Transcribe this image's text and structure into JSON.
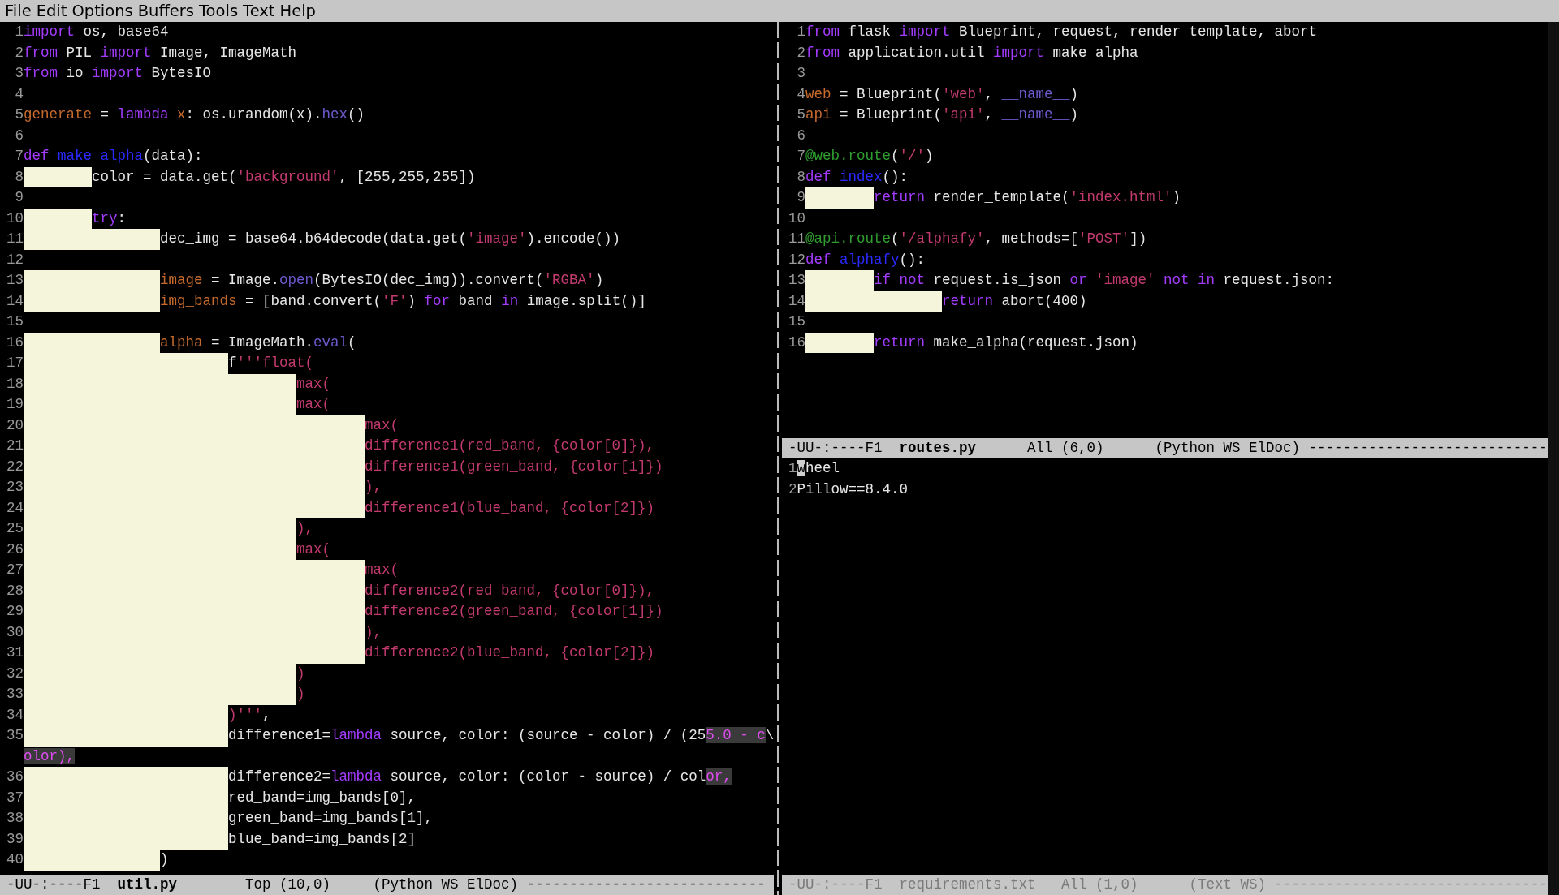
{
  "menu_bar": [
    "File",
    "Edit",
    "Options",
    "Buffers",
    "Tools",
    "Text",
    "Help"
  ],
  "left_pane": {
    "lines": [
      {
        "num": "1",
        "code": [
          {
            "kind": "keyword",
            "text": "import"
          },
          {
            "kind": "plain",
            "text": " os, base64"
          }
        ]
      },
      {
        "num": "2",
        "code": [
          {
            "kind": "keyword",
            "text": "from"
          },
          {
            "kind": "plain",
            "text": " PIL "
          },
          {
            "kind": "keyword",
            "text": "import"
          },
          {
            "kind": "plain",
            "text": " Image, ImageMath"
          }
        ]
      },
      {
        "num": "3",
        "code": [
          {
            "kind": "keyword",
            "text": "from"
          },
          {
            "kind": "plain",
            "text": " io "
          },
          {
            "kind": "keyword",
            "text": "import"
          },
          {
            "kind": "plain",
            "text": " BytesIO"
          }
        ]
      },
      {
        "num": "4"
      },
      {
        "num": "5",
        "code": [
          {
            "kind": "variable",
            "text": "generate"
          },
          {
            "kind": "plain",
            "text": " = "
          },
          {
            "kind": "keyword",
            "text": "lambda "
          },
          {
            "kind": "variable",
            "text": "x"
          },
          {
            "kind": "plain",
            "text": ": os.urandom(x)."
          },
          {
            "kind": "builtin",
            "text": "hex"
          },
          {
            "kind": "plain",
            "text": "()"
          }
        ]
      },
      {
        "num": "6"
      },
      {
        "num": "7",
        "code": [
          {
            "kind": "keyword",
            "text": "def "
          },
          {
            "kind": "function",
            "text": "make_alpha"
          },
          {
            "kind": "plain",
            "text": "(data):"
          }
        ]
      },
      {
        "num": "8",
        "code": [
          {
            "kind": "tab"
          },
          {
            "kind": "plain",
            "text": "color = data.get("
          },
          {
            "kind": "string",
            "text": "'background'"
          },
          {
            "kind": "plain",
            "text": ", [255,255,255])"
          }
        ]
      },
      {
        "num": "9"
      },
      {
        "num": "10",
        "code": [
          {
            "kind": "tab"
          },
          {
            "kind": "keyword",
            "text": "try"
          },
          {
            "kind": "plain",
            "text": ":"
          }
        ]
      },
      {
        "num": "11",
        "code": [
          {
            "kind": "tab"
          },
          {
            "kind": "tab"
          },
          {
            "kind": "plain",
            "text": "dec_img = base64.b64decode(data.get("
          },
          {
            "kind": "string",
            "text": "'image'"
          },
          {
            "kind": "plain",
            "text": ").encode())"
          }
        ]
      },
      {
        "num": "12"
      },
      {
        "num": "13",
        "code": [
          {
            "kind": "tab"
          },
          {
            "kind": "tab"
          },
          {
            "kind": "variable",
            "text": "image"
          },
          {
            "kind": "plain",
            "text": " = Image."
          },
          {
            "kind": "builtin",
            "text": "open"
          },
          {
            "kind": "plain",
            "text": "(BytesIO(dec_img)).convert("
          },
          {
            "kind": "string",
            "text": "'RGBA'"
          },
          {
            "kind": "plain",
            "text": ")"
          }
        ]
      },
      {
        "num": "14",
        "code": [
          {
            "kind": "tab"
          },
          {
            "kind": "tab"
          },
          {
            "kind": "variable",
            "text": "img_bands"
          },
          {
            "kind": "plain",
            "text": " = [band.convert("
          },
          {
            "kind": "string",
            "text": "'F'"
          },
          {
            "kind": "plain",
            "text": ") "
          },
          {
            "kind": "keyword",
            "text": "for"
          },
          {
            "kind": "plain",
            "text": " band "
          },
          {
            "kind": "keyword",
            "text": "in"
          },
          {
            "kind": "plain",
            "text": " image.split()]"
          }
        ]
      },
      {
        "num": "15"
      },
      {
        "num": "16",
        "code": [
          {
            "kind": "tab"
          },
          {
            "kind": "tab"
          },
          {
            "kind": "variable",
            "text": "alpha"
          },
          {
            "kind": "plain",
            "text": " = ImageMath."
          },
          {
            "kind": "builtin",
            "text": "eval"
          },
          {
            "kind": "plain",
            "text": "("
          }
        ]
      },
      {
        "num": "17",
        "code": [
          {
            "kind": "tab"
          },
          {
            "kind": "tab"
          },
          {
            "kind": "tab"
          },
          {
            "kind": "plain",
            "text": "f"
          },
          {
            "kind": "string",
            "text": "'''float("
          }
        ]
      },
      {
        "num": "18",
        "code": [
          {
            "kind": "tab"
          },
          {
            "kind": "tab"
          },
          {
            "kind": "tab"
          },
          {
            "kind": "tab"
          },
          {
            "kind": "string",
            "text": "max("
          }
        ]
      },
      {
        "num": "19",
        "code": [
          {
            "kind": "tab"
          },
          {
            "kind": "tab"
          },
          {
            "kind": "tab"
          },
          {
            "kind": "tab"
          },
          {
            "kind": "string",
            "text": "max("
          }
        ]
      },
      {
        "num": "20",
        "code": [
          {
            "kind": "tab"
          },
          {
            "kind": "tab"
          },
          {
            "kind": "tab"
          },
          {
            "kind": "tab"
          },
          {
            "kind": "tab"
          },
          {
            "kind": "string",
            "text": "max("
          }
        ]
      },
      {
        "num": "21",
        "code": [
          {
            "kind": "tab"
          },
          {
            "kind": "tab"
          },
          {
            "kind": "tab"
          },
          {
            "kind": "tab"
          },
          {
            "kind": "tab"
          },
          {
            "kind": "string",
            "text": "difference1(red_band, {color[0]}),"
          }
        ]
      },
      {
        "num": "22",
        "code": [
          {
            "kind": "tab"
          },
          {
            "kind": "tab"
          },
          {
            "kind": "tab"
          },
          {
            "kind": "tab"
          },
          {
            "kind": "tab"
          },
          {
            "kind": "string",
            "text": "difference1(green_band, {color[1]})"
          }
        ]
      },
      {
        "num": "23",
        "code": [
          {
            "kind": "tab"
          },
          {
            "kind": "tab"
          },
          {
            "kind": "tab"
          },
          {
            "kind": "tab"
          },
          {
            "kind": "tab"
          },
          {
            "kind": "string",
            "text": "),"
          }
        ]
      },
      {
        "num": "24",
        "code": [
          {
            "kind": "tab"
          },
          {
            "kind": "tab"
          },
          {
            "kind": "tab"
          },
          {
            "kind": "tab"
          },
          {
            "kind": "tab"
          },
          {
            "kind": "string",
            "text": "difference1(blue_band, {color[2]})"
          }
        ]
      },
      {
        "num": "25",
        "code": [
          {
            "kind": "tab"
          },
          {
            "kind": "tab"
          },
          {
            "kind": "tab"
          },
          {
            "kind": "tab"
          },
          {
            "kind": "string",
            "text": "),"
          }
        ]
      },
      {
        "num": "26",
        "code": [
          {
            "kind": "tab"
          },
          {
            "kind": "tab"
          },
          {
            "kind": "tab"
          },
          {
            "kind": "tab"
          },
          {
            "kind": "string",
            "text": "max("
          }
        ]
      },
      {
        "num": "27",
        "code": [
          {
            "kind": "tab"
          },
          {
            "kind": "tab"
          },
          {
            "kind": "tab"
          },
          {
            "kind": "tab"
          },
          {
            "kind": "tab"
          },
          {
            "kind": "string",
            "text": "max("
          }
        ]
      },
      {
        "num": "28",
        "code": [
          {
            "kind": "tab"
          },
          {
            "kind": "tab"
          },
          {
            "kind": "tab"
          },
          {
            "kind": "tab"
          },
          {
            "kind": "tab"
          },
          {
            "kind": "string",
            "text": "difference2(red_band, {color[0]}),"
          }
        ]
      },
      {
        "num": "29",
        "code": [
          {
            "kind": "tab"
          },
          {
            "kind": "tab"
          },
          {
            "kind": "tab"
          },
          {
            "kind": "tab"
          },
          {
            "kind": "tab"
          },
          {
            "kind": "string",
            "text": "difference2(green_band, {color[1]})"
          }
        ]
      },
      {
        "num": "30",
        "code": [
          {
            "kind": "tab"
          },
          {
            "kind": "tab"
          },
          {
            "kind": "tab"
          },
          {
            "kind": "tab"
          },
          {
            "kind": "tab"
          },
          {
            "kind": "string",
            "text": "),"
          }
        ]
      },
      {
        "num": "31",
        "code": [
          {
            "kind": "tab"
          },
          {
            "kind": "tab"
          },
          {
            "kind": "tab"
          },
          {
            "kind": "tab"
          },
          {
            "kind": "tab"
          },
          {
            "kind": "string",
            "text": "difference2(blue_band, {color[2]})"
          }
        ]
      },
      {
        "num": "32",
        "code": [
          {
            "kind": "tab"
          },
          {
            "kind": "tab"
          },
          {
            "kind": "tab"
          },
          {
            "kind": "tab"
          },
          {
            "kind": "string",
            "text": ")"
          }
        ]
      },
      {
        "num": "33",
        "code": [
          {
            "kind": "tab"
          },
          {
            "kind": "tab"
          },
          {
            "kind": "tab"
          },
          {
            "kind": "tab"
          },
          {
            "kind": "string",
            "text": ")"
          }
        ]
      },
      {
        "num": "34",
        "code": [
          {
            "kind": "tab"
          },
          {
            "kind": "tab"
          },
          {
            "kind": "tab"
          },
          {
            "kind": "string",
            "text": ")'''"
          },
          {
            "kind": "plain",
            "text": ","
          }
        ]
      },
      {
        "num": "35",
        "code": [
          {
            "kind": "tab"
          },
          {
            "kind": "tab"
          },
          {
            "kind": "tab"
          },
          {
            "kind": "plain",
            "text": "difference1="
          },
          {
            "kind": "keyword",
            "text": "lambda"
          },
          {
            "kind": "plain",
            "text": " source, color: (source - color) / (25"
          },
          {
            "kind": "long",
            "text": "5.0 - c"
          },
          {
            "kind": "plain",
            "text": "\\"
          }
        ]
      },
      {
        "code": [
          {
            "kind": "long",
            "text": "olor),"
          }
        ]
      },
      {
        "num": "36",
        "code": [
          {
            "kind": "tab"
          },
          {
            "kind": "tab"
          },
          {
            "kind": "tab"
          },
          {
            "kind": "plain",
            "text": "difference2="
          },
          {
            "kind": "keyword",
            "text": "lambda"
          },
          {
            "kind": "plain",
            "text": " source, color: (color - source) / col"
          },
          {
            "kind": "long",
            "text": "or,"
          }
        ]
      },
      {
        "num": "37",
        "code": [
          {
            "kind": "tab"
          },
          {
            "kind": "tab"
          },
          {
            "kind": "tab"
          },
          {
            "kind": "plain",
            "text": "red_band=img_bands[0],"
          }
        ]
      },
      {
        "num": "38",
        "code": [
          {
            "kind": "tab"
          },
          {
            "kind": "tab"
          },
          {
            "kind": "tab"
          },
          {
            "kind": "plain",
            "text": "green_band=img_bands[1],"
          }
        ]
      },
      {
        "num": "39",
        "code": [
          {
            "kind": "tab"
          },
          {
            "kind": "tab"
          },
          {
            "kind": "tab"
          },
          {
            "kind": "plain",
            "text": "blue_band=img_bands[2]"
          }
        ]
      },
      {
        "num": "40",
        "code": [
          {
            "kind": "tab"
          },
          {
            "kind": "tab"
          },
          {
            "kind": "plain",
            "text": ")"
          }
        ]
      }
    ],
    "mode_line": {
      "status": "-UU-:----F1",
      "buffer": "util.py",
      "position": "Top (10,0)",
      "mode": "(Python WS ElDoc)",
      "fill": "----------------------------",
      "active": true
    }
  },
  "right_pane": {
    "windows": [
      {
        "lines": [
          {
            "num": "1",
            "code": [
              {
                "kind": "keyword",
                "text": "from"
              },
              {
                "kind": "plain",
                "text": " flask "
              },
              {
                "kind": "keyword",
                "text": "import"
              },
              {
                "kind": "plain",
                "text": " Blueprint, request, render_template, abort"
              }
            ]
          },
          {
            "num": "2",
            "code": [
              {
                "kind": "keyword",
                "text": "from"
              },
              {
                "kind": "plain",
                "text": " application.util "
              },
              {
                "kind": "keyword",
                "text": "import"
              },
              {
                "kind": "plain",
                "text": " make_alpha"
              }
            ]
          },
          {
            "num": "3"
          },
          {
            "num": "4",
            "code": [
              {
                "kind": "variable",
                "text": "web"
              },
              {
                "kind": "plain",
                "text": " = Blueprint("
              },
              {
                "kind": "string",
                "text": "'web'"
              },
              {
                "kind": "plain",
                "text": ", "
              },
              {
                "kind": "builtin",
                "text": "__name__"
              },
              {
                "kind": "plain",
                "text": ")"
              }
            ]
          },
          {
            "num": "5",
            "code": [
              {
                "kind": "variable",
                "text": "api"
              },
              {
                "kind": "plain",
                "text": " = Blueprint("
              },
              {
                "kind": "string",
                "text": "'api'"
              },
              {
                "kind": "plain",
                "text": ", "
              },
              {
                "kind": "builtin",
                "text": "__name__"
              },
              {
                "kind": "plain",
                "text": ")"
              }
            ]
          },
          {
            "num": "6"
          },
          {
            "num": "7",
            "code": [
              {
                "kind": "decorator",
                "text": "@web.route"
              },
              {
                "kind": "plain",
                "text": "("
              },
              {
                "kind": "string",
                "text": "'/'"
              },
              {
                "kind": "plain",
                "text": ")"
              }
            ]
          },
          {
            "num": "8",
            "code": [
              {
                "kind": "keyword",
                "text": "def "
              },
              {
                "kind": "function",
                "text": "index"
              },
              {
                "kind": "plain",
                "text": "():"
              }
            ]
          },
          {
            "num": "9",
            "code": [
              {
                "kind": "tab"
              },
              {
                "kind": "keyword",
                "text": "return"
              },
              {
                "kind": "plain",
                "text": " render_template("
              },
              {
                "kind": "string",
                "text": "'index.html'"
              },
              {
                "kind": "plain",
                "text": ")"
              }
            ]
          },
          {
            "num": "10"
          },
          {
            "num": "11",
            "code": [
              {
                "kind": "decorator",
                "text": "@api.route"
              },
              {
                "kind": "plain",
                "text": "("
              },
              {
                "kind": "string",
                "text": "'/alphafy'"
              },
              {
                "kind": "plain",
                "text": ", methods=["
              },
              {
                "kind": "string",
                "text": "'POST'"
              },
              {
                "kind": "plain",
                "text": "])"
              }
            ]
          },
          {
            "num": "12",
            "code": [
              {
                "kind": "keyword",
                "text": "def "
              },
              {
                "kind": "function",
                "text": "alphafy"
              },
              {
                "kind": "plain",
                "text": "():"
              }
            ]
          },
          {
            "num": "13",
            "code": [
              {
                "kind": "tab"
              },
              {
                "kind": "keyword",
                "text": "if not"
              },
              {
                "kind": "plain",
                "text": " request.is_json "
              },
              {
                "kind": "keyword",
                "text": "or "
              },
              {
                "kind": "string",
                "text": "'image'"
              },
              {
                "kind": "keyword",
                "text": " not in"
              },
              {
                "kind": "plain",
                "text": " request.json:"
              }
            ]
          },
          {
            "num": "14",
            "code": [
              {
                "kind": "tab"
              },
              {
                "kind": "tab"
              },
              {
                "kind": "keyword",
                "text": "return"
              },
              {
                "kind": "plain",
                "text": " abort(400)"
              }
            ]
          },
          {
            "num": "15"
          },
          {
            "num": "16",
            "code": [
              {
                "kind": "tab"
              },
              {
                "kind": "keyword",
                "text": "return"
              },
              {
                "kind": "plain",
                "text": " make_alpha(request.json)"
              }
            ]
          }
        ],
        "mode_line": {
          "status": "-UU-:----F1",
          "buffer": "routes.py",
          "position": "All (6,0)",
          "mode": "(Python WS ElDoc)",
          "fill": "----------------------------",
          "active": true
        }
      },
      {
        "lines": [
          {
            "num": "1",
            "code": [
              {
                "kind": "cursor",
                "text": "w"
              },
              {
                "kind": "plain",
                "text": "heel"
              }
            ]
          },
          {
            "num": "2",
            "code": [
              {
                "kind": "plain",
                "text": "Pillow==8.4.0"
              }
            ]
          }
        ],
        "mode_line": {
          "status": "-UU-:----F1",
          "buffer": "requirements.txt",
          "position": "All (1,0)",
          "mode": "(Text WS)",
          "fill": "--------------------------------",
          "active": false
        }
      }
    ]
  }
}
